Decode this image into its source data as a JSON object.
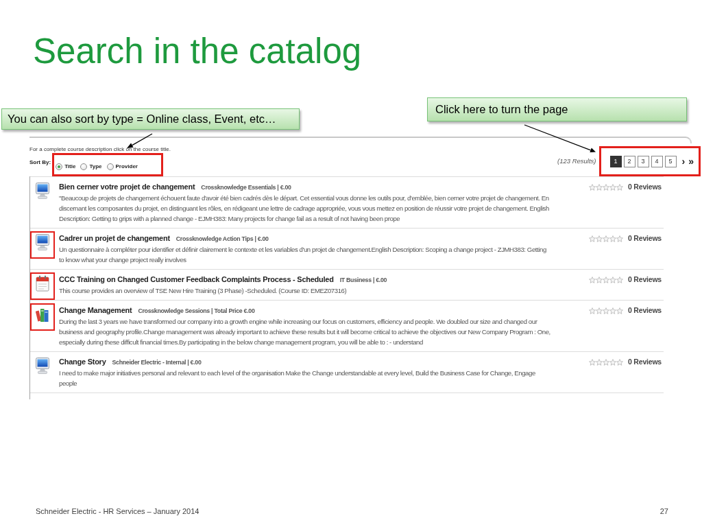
{
  "slide": {
    "title": "Search in the catalog",
    "footer": "Schneider Electric - HR Services – January 2014",
    "page_number": "27"
  },
  "callouts": [
    {
      "text": "You can also sort by type = Online class, Event, etc…"
    },
    {
      "text": "Click here to turn the page"
    }
  ],
  "catalog": {
    "hint": "For a complete course description click on the course title.",
    "sort": {
      "label": "Sort By:",
      "highlighted": true,
      "options": [
        {
          "label": "Title",
          "selected": true
        },
        {
          "label": "Type",
          "selected": false
        },
        {
          "label": "Provider",
          "selected": false
        }
      ]
    },
    "results": "(123 Results)",
    "pagination": {
      "highlighted": true,
      "pages": [
        {
          "label": "1",
          "selected": true
        },
        {
          "label": "2",
          "selected": false
        },
        {
          "label": "3",
          "selected": false
        },
        {
          "label": "4",
          "selected": false
        },
        {
          "label": "5",
          "selected": false
        }
      ],
      "next": "›",
      "last": "»"
    },
    "courses": [
      {
        "kind": "online",
        "highlighted": false,
        "title": "Bien cerner votre projet de changement",
        "meta": "Crossknowledge Essentials | €.00",
        "description": "\"Beaucoup de projets de changement échouent faute d'avoir été bien cadrés dès le départ. Cet essential vous donne les outils pour, d'emblée, bien cerner votre projet de changement. En discernant les composantes du projet, en distinguant les rôles, en rédigeant une lettre de cadrage appropriée, vous vous mettez en position de réussir votre projet de changement. English Description: Getting to grips with a planned change - EJMH383: Many projects for change fail as a result of not having been prope",
        "stars": 0,
        "reviews": "0 Reviews"
      },
      {
        "kind": "online",
        "highlighted": true,
        "title": "Cadrer un projet de changement",
        "meta": "Crossknowledge Action Tips | €.00",
        "description": "Un questionnaire à compléter pour identifier et définir clairement le contexte et les variables d'un projet de changement.English Description: Scoping a change project - ZJMH383: Getting to know what your change project really involves",
        "stars": 0,
        "reviews": "0 Reviews"
      },
      {
        "kind": "event",
        "highlighted": true,
        "title": "CCC Training on Changed Customer Feedback Complaints Process - Scheduled",
        "meta": "IT Business | €.00",
        "description": "This course provides an overview of TSE New Hire Training (3 Phase) -Scheduled. (Course ID: EMEZ07316)",
        "stars": 0,
        "reviews": "0 Reviews"
      },
      {
        "kind": "session",
        "highlighted": true,
        "title": "Change Management",
        "meta": "Crossknowledge Sessions | Total Price €.00",
        "description": "During the last 3 years we have transformed our company into a growth engine while increasing our focus on customers, efficiency and people. We doubled our size and changed our business and geography profile.Change management was already important to achieve these results but it will become critical to achieve the objectives our New Company Program : One, especially during these difficult financial times.By participating in the below change management program, you will be able to : - understand",
        "stars": 0,
        "reviews": "0 Reviews"
      },
      {
        "kind": "online",
        "highlighted": false,
        "title": "Change Story",
        "meta": "Schneider Electric - Internal | €.00",
        "description": "I need to make major initiatives personal and relevant to each level of the organisation Make the Change understandable at every level, Build the Business Case for Change, Engage people",
        "stars": 0,
        "reviews": "0 Reviews"
      }
    ]
  }
}
